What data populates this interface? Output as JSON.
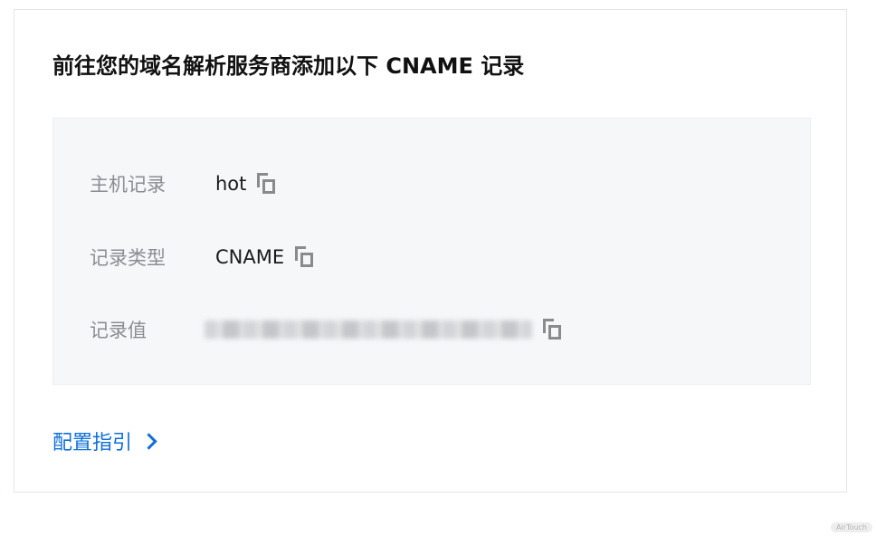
{
  "card": {
    "title": "前往您的域名解析服务商添加以下 CNAME 记录"
  },
  "records": [
    {
      "label": "主机记录",
      "value": "hot",
      "icon": "copy-icon"
    },
    {
      "label": "记录类型",
      "value": "CNAME",
      "icon": "copy-icon"
    },
    {
      "label": "记录值",
      "value": "",
      "icon": "copy-icon"
    }
  ],
  "guide": {
    "label": "配置指引",
    "icon": "chevron-right-icon"
  },
  "watermark": "AirTouch",
  "colors": {
    "link": "#0f6fd8",
    "label": "#8a8d93",
    "panel_bg": "#f6f7f9"
  }
}
